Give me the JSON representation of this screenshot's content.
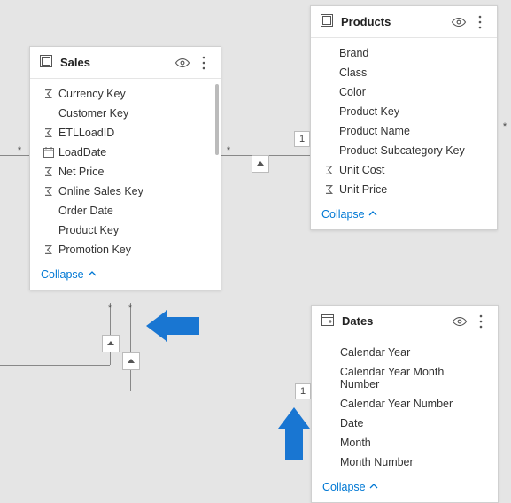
{
  "tables": {
    "sales": {
      "title": "Sales",
      "collapse_label": "Collapse",
      "fields": [
        {
          "icon": "sigma",
          "label": "Currency Key"
        },
        {
          "icon": "",
          "label": "Customer Key"
        },
        {
          "icon": "sigma",
          "label": "ETLLoadID"
        },
        {
          "icon": "date",
          "label": "LoadDate"
        },
        {
          "icon": "sigma",
          "label": "Net Price"
        },
        {
          "icon": "sigma",
          "label": "Online Sales Key"
        },
        {
          "icon": "",
          "label": "Order Date"
        },
        {
          "icon": "",
          "label": "Product Key"
        },
        {
          "icon": "sigma",
          "label": "Promotion Key"
        }
      ]
    },
    "products": {
      "title": "Products",
      "collapse_label": "Collapse",
      "fields": [
        {
          "icon": "",
          "label": "Brand"
        },
        {
          "icon": "",
          "label": "Class"
        },
        {
          "icon": "",
          "label": "Color"
        },
        {
          "icon": "",
          "label": "Product Key"
        },
        {
          "icon": "",
          "label": "Product Name"
        },
        {
          "icon": "",
          "label": "Product Subcategory Key"
        },
        {
          "icon": "sigma",
          "label": "Unit Cost"
        },
        {
          "icon": "sigma",
          "label": "Unit Price"
        }
      ]
    },
    "dates": {
      "title": "Dates",
      "collapse_label": "Collapse",
      "fields": [
        {
          "icon": "",
          "label": "Calendar Year"
        },
        {
          "icon": "",
          "label": "Calendar Year Month Number"
        },
        {
          "icon": "",
          "label": "Calendar Year Number"
        },
        {
          "icon": "",
          "label": "Date"
        },
        {
          "icon": "",
          "label": "Month"
        },
        {
          "icon": "",
          "label": "Month Number"
        }
      ]
    }
  },
  "relationships": {
    "sales_products": {
      "many_side": "*",
      "one_side": "1"
    },
    "sales_dates": {
      "many_side_a": "*",
      "many_side_b": "*",
      "one_side": "1"
    },
    "sales_left": {
      "many_side": "*"
    },
    "products_right": {
      "many_side": "*"
    }
  }
}
